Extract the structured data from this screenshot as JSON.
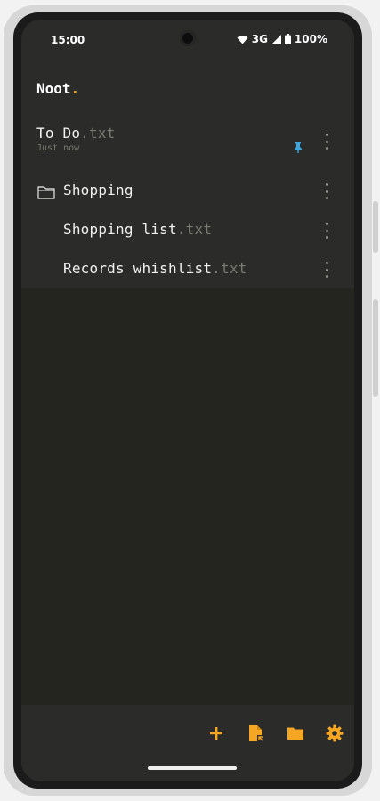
{
  "status": {
    "time": "15:00",
    "network": "3G",
    "battery": "100%"
  },
  "app": {
    "title": "Noot",
    "title_dot": "."
  },
  "files": [
    {
      "name": "To Do",
      "ext": ".txt",
      "subtitle": "Just now",
      "pinned": true
    },
    {
      "name": "Shopping",
      "type": "folder"
    },
    {
      "name": "Shopping list",
      "ext": ".txt"
    },
    {
      "name": "Records whishlist",
      "ext": ".txt"
    }
  ],
  "bottom_actions": [
    "add-icon",
    "new-file-icon",
    "folder-icon",
    "settings-icon"
  ],
  "colors": {
    "accent": "#f5a623",
    "pin": "#3fa7e0",
    "background": "#252520",
    "surface": "#2b2b29"
  }
}
